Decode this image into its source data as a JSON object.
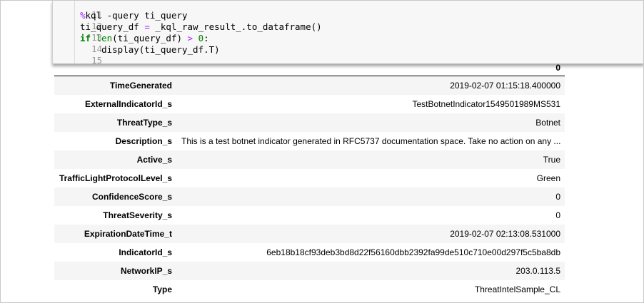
{
  "code_cell": {
    "lines": [
      {
        "num": "11",
        "text": ""
      },
      {
        "num": "12",
        "text": "%kql -query ti_query"
      },
      {
        "num": "13",
        "text": "ti_query_df = _kql_raw_result_.to_dataframe()"
      },
      {
        "num": "14",
        "text": "if len(ti_query_df) > 0:"
      },
      {
        "num": "15",
        "text": "    display(ti_query_df.T)"
      }
    ]
  },
  "output_table": {
    "column_header": "0",
    "rows": [
      {
        "field": "TimeGenerated",
        "value": "2019-02-07 01:15:18.400000"
      },
      {
        "field": "ExternalIndicatorId_s",
        "value": "TestBotnetIndicator1549501989MS531"
      },
      {
        "field": "ThreatType_s",
        "value": "Botnet"
      },
      {
        "field": "Description_s",
        "value": "This is a test botnet indicator generated in RFC5737 documentation space. Take no action on any ..."
      },
      {
        "field": "Active_s",
        "value": "True"
      },
      {
        "field": "TrafficLightProtocolLevel_s",
        "value": "Green"
      },
      {
        "field": "ConfidenceScore_s",
        "value": "0"
      },
      {
        "field": "ThreatSeverity_s",
        "value": "0"
      },
      {
        "field": "ExpirationDateTime_t",
        "value": "2019-02-07 02:13:08.531000"
      },
      {
        "field": "IndicatorId_s",
        "value": "6eb18b18cf93deb3bd8d22f56160dbb2392fa99de510c710e00d297f5c5ba8db"
      },
      {
        "field": "NetworkIP_s",
        "value": "203.0.113.5"
      },
      {
        "field": "Type",
        "value": "ThreatIntelSample_CL"
      }
    ]
  }
}
